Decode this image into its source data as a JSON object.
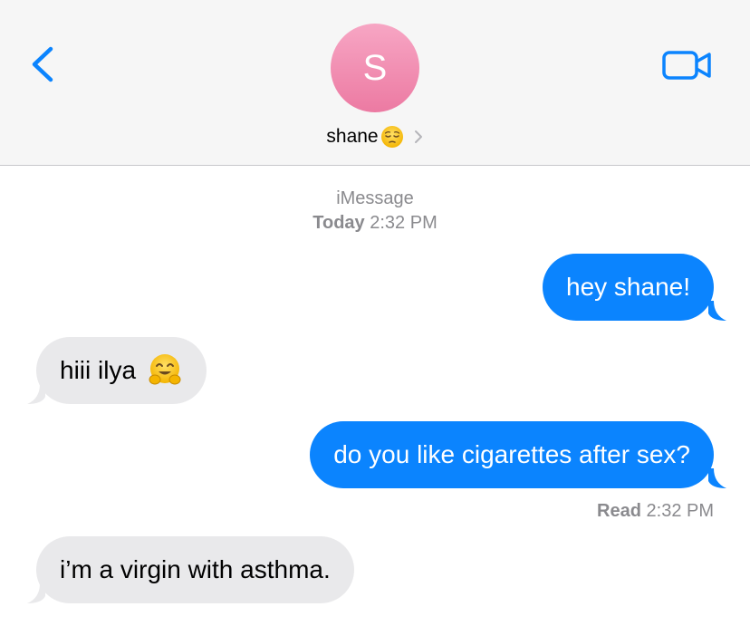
{
  "header": {
    "avatar_initial": "S",
    "contact_name": "shane",
    "contact_emoji": "pensive-face",
    "back_icon": "chevron-left-icon",
    "video_icon": "video-camera-icon",
    "accent_color": "#0b84fe",
    "avatar_color": "#f09ab8"
  },
  "meta": {
    "service": "iMessage",
    "day": "Today",
    "time": "2:32 PM"
  },
  "messages": [
    {
      "direction": "outgoing",
      "text": "hey shane!"
    },
    {
      "direction": "incoming",
      "text": "hiii ilya",
      "emoji": "hugging-face"
    },
    {
      "direction": "outgoing",
      "text": "do you like cigarettes after sex?"
    },
    {
      "direction": "incoming",
      "text": "i’m a virgin with asthma."
    }
  ],
  "receipt": {
    "label": "Read",
    "time": "2:32 PM"
  },
  "colors": {
    "outgoing_bubble": "#0b84fe",
    "incoming_bubble": "#e9e9eb",
    "meta_text": "#8a8a8e"
  }
}
